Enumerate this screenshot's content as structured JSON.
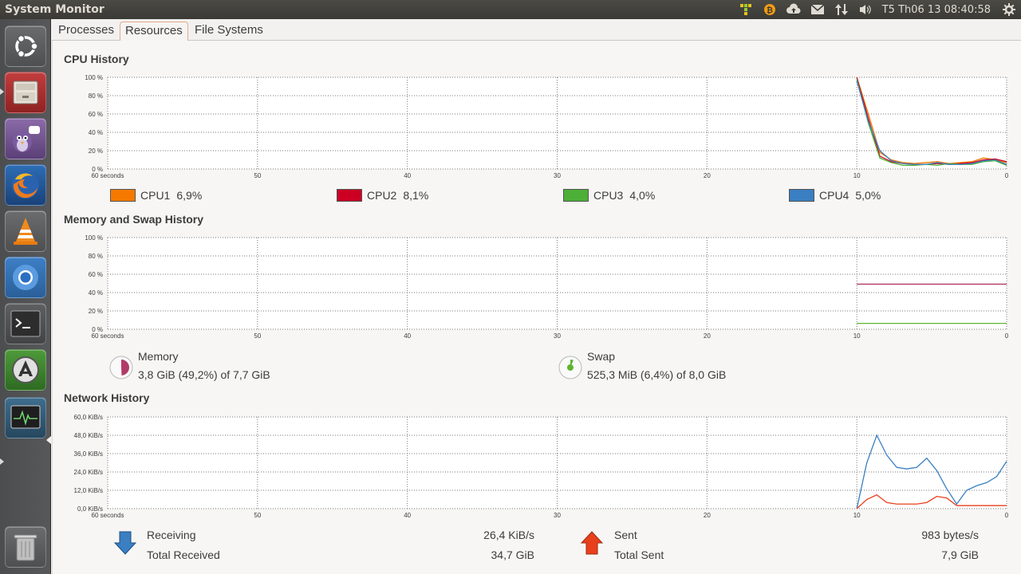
{
  "window": {
    "title": "System Monitor"
  },
  "tray": {
    "clock": "T5 Th06 13 08:40:58",
    "icons": [
      "network-grid-icon",
      "bitcoin-icon",
      "cloud-upload-icon",
      "mail-icon",
      "network-updown-icon",
      "volume-icon",
      "settings-gear-icon"
    ]
  },
  "launcher": {
    "items": [
      "ubuntu-dash",
      "file-manager",
      "pidgin",
      "firefox",
      "vlc",
      "chromium",
      "terminal",
      "software-updater",
      "system-monitor",
      "trash"
    ]
  },
  "tabs": [
    {
      "label": "Processes",
      "active": false
    },
    {
      "label": "Resources",
      "active": true
    },
    {
      "label": "File Systems",
      "active": false
    }
  ],
  "cpu": {
    "title": "CPU History",
    "yticks": [
      "100 %",
      "80 %",
      "60 %",
      "40 %",
      "20 %",
      "0 %"
    ],
    "xticks": [
      "60 seconds",
      "50",
      "40",
      "30",
      "20",
      "10",
      "0"
    ],
    "legend": [
      {
        "name": "CPU1",
        "value": "6,9%",
        "color": "#f57900"
      },
      {
        "name": "CPU2",
        "value": "8,1%",
        "color": "#cc0022"
      },
      {
        "name": "CPU3",
        "value": "4,0%",
        "color": "#4caf37"
      },
      {
        "name": "CPU4",
        "value": "5,0%",
        "color": "#3a7fc1"
      }
    ]
  },
  "memory": {
    "title": "Memory and Swap History",
    "yticks": [
      "100 %",
      "80 %",
      "60 %",
      "40 %",
      "20 %",
      "0 %"
    ],
    "xticks": [
      "60 seconds",
      "50",
      "40",
      "30",
      "20",
      "10",
      "0"
    ],
    "memory_label": "Memory",
    "memory_value": "3,8 GiB (49,2%) of 7,7 GiB",
    "memory_percent": 49.2,
    "memory_color": "#b23a68",
    "swap_label": "Swap",
    "swap_value": "525,3 MiB (6,4%) of 8,0 GiB",
    "swap_percent": 6.4,
    "swap_color": "#5fb52e"
  },
  "network": {
    "title": "Network History",
    "yticks": [
      "60,0 KiB/s",
      "48,0 KiB/s",
      "36,0 KiB/s",
      "24,0 KiB/s",
      "12,0 KiB/s",
      "0,0 KiB/s"
    ],
    "xticks": [
      "60 seconds",
      "50",
      "40",
      "30",
      "20",
      "10",
      "0"
    ],
    "receiving_label": "Receiving",
    "receiving_value": "26,4 KiB/s",
    "total_received_label": "Total Received",
    "total_received_value": "34,7 GiB",
    "sent_label": "Sent",
    "sent_value": "983 bytes/s",
    "total_sent_label": "Total Sent",
    "total_sent_value": "7,9 GiB",
    "receive_color": "#3a7fc1",
    "sent_color": "#e8401c"
  }
}
